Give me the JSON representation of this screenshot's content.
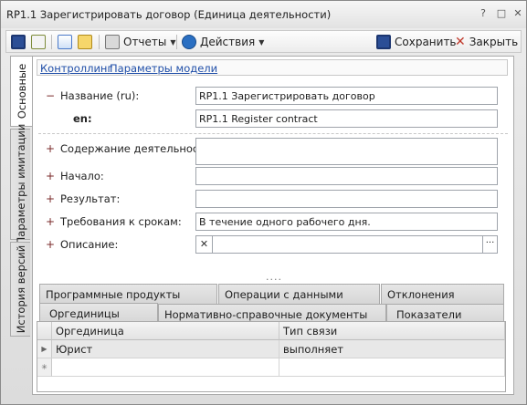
{
  "window": {
    "title": "RP1.1 Зарегистрировать договор (Единица деятельности)",
    "help": "?",
    "maximize": "□",
    "close": "✕"
  },
  "toolbar": {
    "reports": "Отчеты",
    "actions": "Действия",
    "save": "Сохранить",
    "close": "Закрыть",
    "colors": {
      "save": "#2b4e96",
      "close": "#c0392b",
      "actions": "#2a6fc2"
    }
  },
  "side_tabs": [
    "Основные",
    "Параметры имитации",
    "История версий"
  ],
  "links": [
    "Контроллинг",
    "Параметры модели"
  ],
  "form": {
    "name_label": "Название (ru):",
    "name_value": "RP1.1 Зарегистрировать договор",
    "en_label": "en:",
    "en_value": "RP1.1 Register contract",
    "content_label": "Содержание деятельности:",
    "content_value": "",
    "start_label": "Начало:",
    "start_value": "",
    "result_label": "Результат:",
    "result_value": "",
    "terms_label": "Требования к срокам:",
    "terms_value": "В течение одного рабочего дня.",
    "desc_label": "Описание:",
    "desc_value": "",
    "collapse": "−",
    "expand": "+",
    "ellipsis": "....",
    "clear_glyph": "✕",
    "more_glyph": "···"
  },
  "bottom_tabs": {
    "row1": [
      "Программные продукты",
      "Операции с данными",
      "Отклонения"
    ],
    "row2": [
      "Оргединицы",
      "Нормативно-справочные документы",
      "Показатели"
    ],
    "active": "Оргединицы"
  },
  "grid": {
    "columns": [
      "Оргединица",
      "Тип связи"
    ],
    "rows": [
      [
        "Юрист",
        "выполняет"
      ]
    ],
    "current_marker": "▶",
    "new_row_marker": "✳"
  }
}
